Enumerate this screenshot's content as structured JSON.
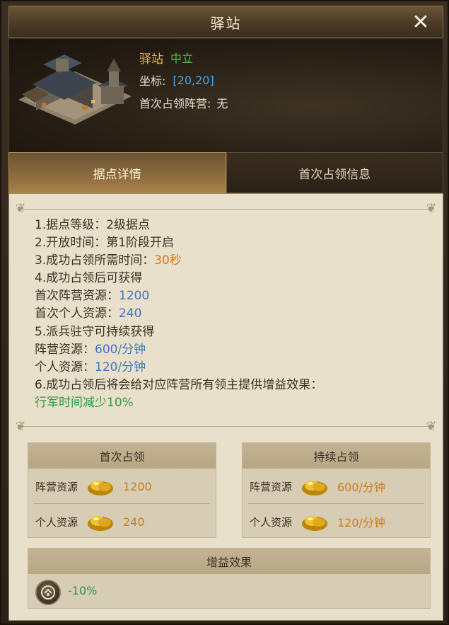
{
  "window": {
    "title": "驿站",
    "close_icon": "close-icon"
  },
  "station": {
    "name": "驿站",
    "status": "中立",
    "coord_label": "坐标:",
    "coord_value": "[20,20]",
    "first_capture_label": "首次占领阵营:",
    "first_capture_value": "无"
  },
  "tabs": [
    {
      "label": "据点详情",
      "active": true
    },
    {
      "label": "首次占领信息",
      "active": false
    }
  ],
  "details": {
    "line1": "1.据点等级：2级据点",
    "line2": "2.开放时间：第1阶段开启",
    "line3_prefix": "3.成功占领所需时间：",
    "line3_value": "30秒",
    "line4": "4.成功占领后可获得",
    "line5_prefix": "首次阵营资源：",
    "line5_value": "1200",
    "line6_prefix": "首次个人资源：",
    "line6_value": "240",
    "line7": "5.派兵驻守可持续获得",
    "line8_prefix": "阵营资源：",
    "line8_value": "600/分钟",
    "line9_prefix": "个人资源：",
    "line9_value": "120/分钟",
    "line10": "6.成功占领后将会给对应阵营所有领主提供增益效果：",
    "line11": "行军时间减少10%"
  },
  "first_capture": {
    "title": "首次占领",
    "rows": [
      {
        "label": "阵营资源",
        "icon": "gold-icon",
        "value": "1200"
      },
      {
        "label": "个人资源",
        "icon": "gold-icon",
        "value": "240"
      }
    ]
  },
  "continuous_capture": {
    "title": "持续占领",
    "rows": [
      {
        "label": "阵营资源",
        "icon": "gold-icon",
        "value": "600/分钟"
      },
      {
        "label": "个人资源",
        "icon": "gold-icon",
        "value": "120/分钟"
      }
    ]
  },
  "buff": {
    "title": "增益效果",
    "icon": "march-speed-icon",
    "value": "-10%"
  },
  "colors": {
    "name": "#f0b03a",
    "neutral": "#56c04a",
    "coord": "#4aa3e8",
    "blue_value": "#3d74c6",
    "orange_value": "#d27a18",
    "green_value": "#2f9a46"
  }
}
